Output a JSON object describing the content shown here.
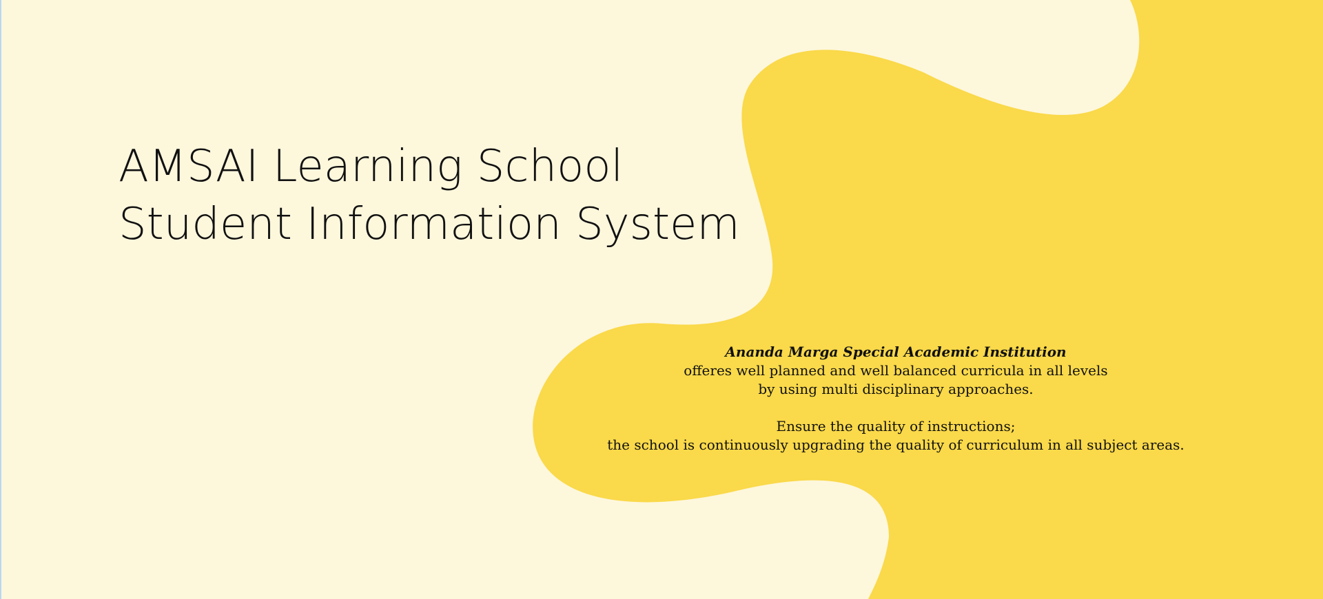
{
  "colors": {
    "background": "#fdf7dc",
    "accent_blob": "#fad94a",
    "text": "#111111"
  },
  "hero": {
    "title_line1": "AMSAI Learning School",
    "title_line2": "Student Information System"
  },
  "tagline": {
    "institution": "Ananda Marga Special Academic Institution",
    "line1": "offeres well planned and well balanced curricula in all levels",
    "line2": "by using multi disciplinary approaches.",
    "line3": "Ensure the quality of instructions;",
    "line4": "the school is continuously upgrading the quality of curriculum in all subject areas."
  }
}
